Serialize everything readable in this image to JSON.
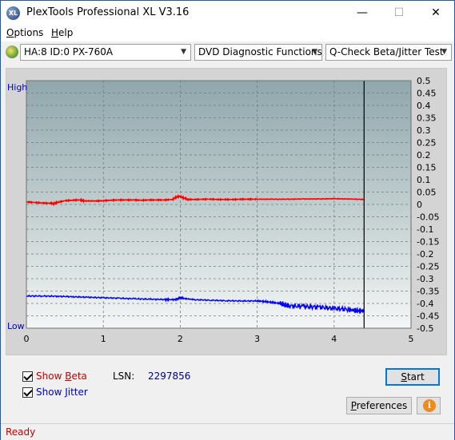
{
  "window": {
    "title": "PlexTools Professional XL V3.16",
    "icon_text": "XL",
    "minimize_glyph": "—",
    "maximize_glyph": "☐",
    "close_glyph": "✕"
  },
  "menu": [
    {
      "accel": "O",
      "rest": "ptions"
    },
    {
      "accel": "H",
      "rest": "elp"
    }
  ],
  "toolbar": {
    "drive": "HA:8 ID:0  PX-760A",
    "function": "DVD Diagnostic Functions",
    "test": "Q-Check Beta/Jitter Test"
  },
  "chart_data": {
    "type": "line",
    "y_left_labels": [
      "High",
      "Low"
    ],
    "x_ticks": [
      "0",
      "1",
      "2",
      "3",
      "4",
      "5"
    ],
    "xlim": [
      0,
      5
    ],
    "y_right_ticks": [
      "0.5",
      "0.45",
      "0.4",
      "0.35",
      "0.3",
      "0.25",
      "0.2",
      "0.15",
      "0.1",
      "0.05",
      "0",
      "-0.05",
      "-0.1",
      "-0.15",
      "-0.2",
      "-0.25",
      "-0.3",
      "-0.35",
      "-0.4",
      "-0.45",
      "-0.5"
    ],
    "ylim": [
      -0.5,
      0.5
    ],
    "end_marker_x": 4.39,
    "grid": true,
    "series": [
      {
        "name": "Beta",
        "color": "#ff0000",
        "x": [
          0,
          0.1,
          0.2,
          0.3,
          0.35,
          0.4,
          0.5,
          0.6,
          0.7,
          0.75,
          0.9,
          1.0,
          1.1,
          1.2,
          1.3,
          1.4,
          1.5,
          1.6,
          1.7,
          1.8,
          1.9,
          1.95,
          2.0,
          2.05,
          2.1,
          2.2,
          2.3,
          2.4,
          2.5,
          2.6,
          2.7,
          2.8,
          2.9,
          3.0,
          3.2,
          3.4,
          3.6,
          3.8,
          4.0,
          4.2,
          4.39
        ],
        "y": [
          0.01,
          0.008,
          0.006,
          0.005,
          0.003,
          0.008,
          0.015,
          0.017,
          0.018,
          0.014,
          0.014,
          0.015,
          0.017,
          0.018,
          0.018,
          0.018,
          0.017,
          0.018,
          0.018,
          0.018,
          0.02,
          0.03,
          0.033,
          0.025,
          0.02,
          0.02,
          0.021,
          0.021,
          0.02,
          0.02,
          0.02,
          0.021,
          0.021,
          0.021,
          0.021,
          0.021,
          0.022,
          0.022,
          0.023,
          0.022,
          0.02
        ]
      },
      {
        "name": "Jitter",
        "color": "#0000ff",
        "x": [
          0,
          0.2,
          0.4,
          0.6,
          0.8,
          1.0,
          1.2,
          1.4,
          1.6,
          1.8,
          1.9,
          1.95,
          2.0,
          2.05,
          2.2,
          2.4,
          2.6,
          2.8,
          3.0,
          3.1,
          3.2,
          3.3,
          3.35,
          3.4,
          3.6,
          3.8,
          4.0,
          4.2,
          4.3,
          4.39
        ],
        "y": [
          -0.37,
          -0.37,
          -0.371,
          -0.373,
          -0.375,
          -0.377,
          -0.379,
          -0.381,
          -0.383,
          -0.384,
          -0.385,
          -0.383,
          -0.377,
          -0.38,
          -0.385,
          -0.387,
          -0.389,
          -0.39,
          -0.39,
          -0.392,
          -0.396,
          -0.4,
          -0.405,
          -0.41,
          -0.412,
          -0.415,
          -0.42,
          -0.425,
          -0.43,
          -0.43
        ]
      }
    ]
  },
  "bottom": {
    "show_beta": {
      "pre": "Show ",
      "accel": "B",
      "rest": "eta"
    },
    "show_jitter": {
      "pre": "Show ",
      "accel": "J",
      "rest": "itter"
    },
    "lsn_label": "LSN:",
    "lsn_value": "2297856",
    "start_button": {
      "accel": "S",
      "rest": "tart"
    },
    "preferences_button": {
      "accel": "P",
      "rest": "references"
    },
    "info_glyph": "i"
  },
  "status": "Ready",
  "colors": {
    "beta": "#ff0000",
    "jitter": "#0000ff",
    "axis_label": "#0000c0",
    "status": "#c00000"
  }
}
